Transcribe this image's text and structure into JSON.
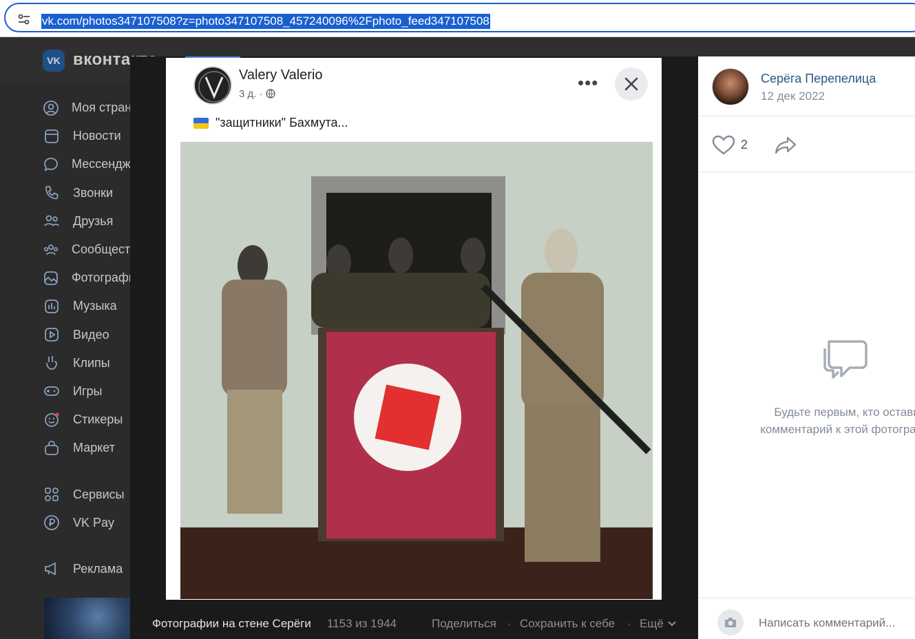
{
  "browser": {
    "url": "vk.com/photos347107508?z=photo347107508_457240096%2Fphoto_feed347107508"
  },
  "vk": {
    "logo_text": "вконтакте",
    "sidebar": [
      {
        "label": "Моя страница",
        "icon": "user-icon"
      },
      {
        "label": "Новости",
        "icon": "news-icon"
      },
      {
        "label": "Мессенджер",
        "icon": "message-icon"
      },
      {
        "label": "Звонки",
        "icon": "phone-icon"
      },
      {
        "label": "Друзья",
        "icon": "friends-icon"
      },
      {
        "label": "Сообщества",
        "icon": "communities-icon"
      },
      {
        "label": "Фотографии",
        "icon": "photo-icon"
      },
      {
        "label": "Музыка",
        "icon": "music-icon"
      },
      {
        "label": "Видео",
        "icon": "video-icon"
      },
      {
        "label": "Клипы",
        "icon": "clips-icon"
      },
      {
        "label": "Игры",
        "icon": "games-icon"
      },
      {
        "label": "Стикеры",
        "icon": "stickers-icon"
      },
      {
        "label": "Маркет",
        "icon": "market-icon"
      }
    ],
    "sidebar_secondary": [
      {
        "label": "Сервисы",
        "icon": "services-icon"
      },
      {
        "label": "VK Pay",
        "icon": "vkpay-icon"
      }
    ],
    "sidebar_ads": {
      "label": "Реклама",
      "icon": "megaphone-icon"
    }
  },
  "photo": {
    "fb_author": "Valery Valerio",
    "fb_meta": "3 д. · ",
    "fb_caption": "\"защитники\" Бахмута..."
  },
  "viewer_footer": {
    "album": "Фотографии на стене Серёги",
    "count": "1153 из 1944",
    "share": "Поделиться",
    "separator": "·",
    "save": "Сохранить к себе",
    "more": "Ещё"
  },
  "right_panel": {
    "author_name": "Серёга Перепелица",
    "date": "12 дек 2022",
    "likes": "2",
    "empty_text_line1": "Будьте первым, кто оставит",
    "empty_text_line2": "комментарий к этой фотографии",
    "comment_placeholder": "Написать комментарий..."
  }
}
